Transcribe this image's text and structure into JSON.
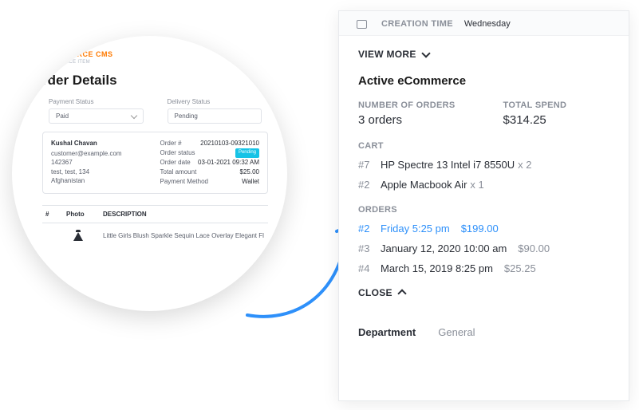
{
  "circle": {
    "brand": "ECOMMERCE CMS",
    "brand_sub": "ECOMMERCE ITEM",
    "title": "rder Details",
    "payment_status_label": "Payment Status",
    "payment_status_value": "Paid",
    "delivery_status_label": "Delivery Status",
    "delivery_status_value": "Pending",
    "customer": {
      "name": "Kushal Chavan",
      "email": "customer@example.com",
      "id": "142367",
      "address": "test, test, 134",
      "country": "Afghanistan"
    },
    "order_details": [
      {
        "k": "Order #",
        "v": "20210103-09321010",
        "cls": "link-blue"
      },
      {
        "k": "Order status",
        "v": "Pending",
        "cls": "badge"
      },
      {
        "k": "Order date",
        "v": "03-01-2021 09:32 AM",
        "cls": ""
      },
      {
        "k": "Total amount",
        "v": "$25.00",
        "cls": ""
      },
      {
        "k": "Payment Method",
        "v": "Wallet",
        "cls": ""
      }
    ],
    "table": {
      "headers": {
        "hash": "#",
        "photo": "Photo",
        "description": "DESCRIPTION"
      },
      "rows": [
        {
          "desc": "Little Girls Blush Sparkle Sequin Lace Overlay Elegant Fl"
        }
      ]
    }
  },
  "panel": {
    "creation_label": "CREATION TIME",
    "creation_value": "Wednesday",
    "view_more": "VIEW MORE",
    "section_title": "Active eCommerce",
    "orders_label": "NUMBER OF ORDERS",
    "orders_value": "3 orders",
    "spend_label": "TOTAL SPEND",
    "spend_value": "$314.25",
    "cart_label": "CART",
    "cart": [
      {
        "num": "#7",
        "name": "HP Spectre 13 Intel i7 8550U",
        "qty": "x 2"
      },
      {
        "num": "#2",
        "name": "Apple Macbook Air",
        "qty": "x 1"
      }
    ],
    "orders_header": "ORDERS",
    "orders": [
      {
        "num": "#2",
        "date": "Friday 5:25 pm",
        "price": "$199.00",
        "highlight": true
      },
      {
        "num": "#3",
        "date": "January 12, 2020 10:00 am",
        "price": "$90.00",
        "highlight": false
      },
      {
        "num": "#4",
        "date": "March 15, 2019 8:25 pm",
        "price": "$25.25",
        "highlight": false
      }
    ],
    "close": "CLOSE",
    "tabs": [
      {
        "label": "Department",
        "active": true
      },
      {
        "label": "General",
        "active": false
      }
    ]
  }
}
